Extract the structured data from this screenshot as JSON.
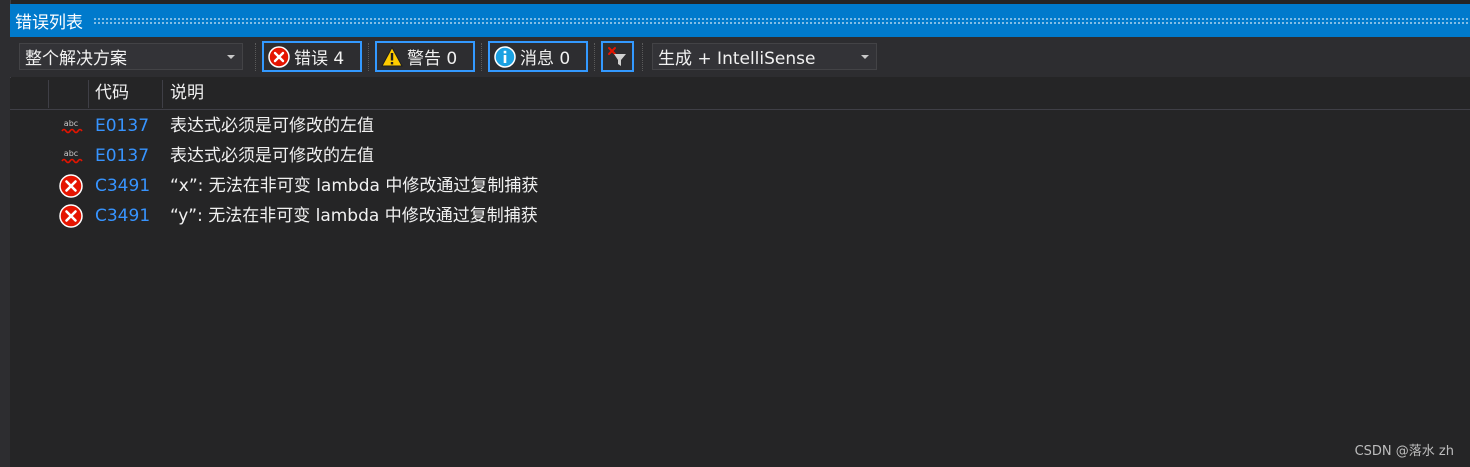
{
  "window": {
    "title": "错误列表"
  },
  "toolbar": {
    "scope_value": "整个解决方案",
    "errors_label": "错误 4",
    "warnings_label": "警告 0",
    "messages_label": "消息 0",
    "filter_icon": "clear-filter-icon",
    "source_value": "生成 + IntelliSense"
  },
  "grid": {
    "columns": [
      "",
      "代码",
      "说明"
    ],
    "rows": [
      {
        "icon": "spelling-squiggle-icon",
        "code": "E0137",
        "description": "表达式必须是可修改的左值"
      },
      {
        "icon": "spelling-squiggle-icon",
        "code": "E0137",
        "description": "表达式必须是可修改的左值"
      },
      {
        "icon": "error-icon",
        "code": "C3491",
        "description": "“x”: 无法在非可变 lambda 中修改通过复制捕获"
      },
      {
        "icon": "error-icon",
        "code": "C3491",
        "description": "“y”: 无法在非可变 lambda 中修改通过复制捕获"
      }
    ]
  },
  "watermark": "CSDN @落水 zh",
  "colors": {
    "accent": "#007acc",
    "link": "#3794ff",
    "error_red": "#e51400",
    "warning_yellow": "#ffcc00",
    "info_blue": "#1ba1e2",
    "background": "#252526"
  }
}
